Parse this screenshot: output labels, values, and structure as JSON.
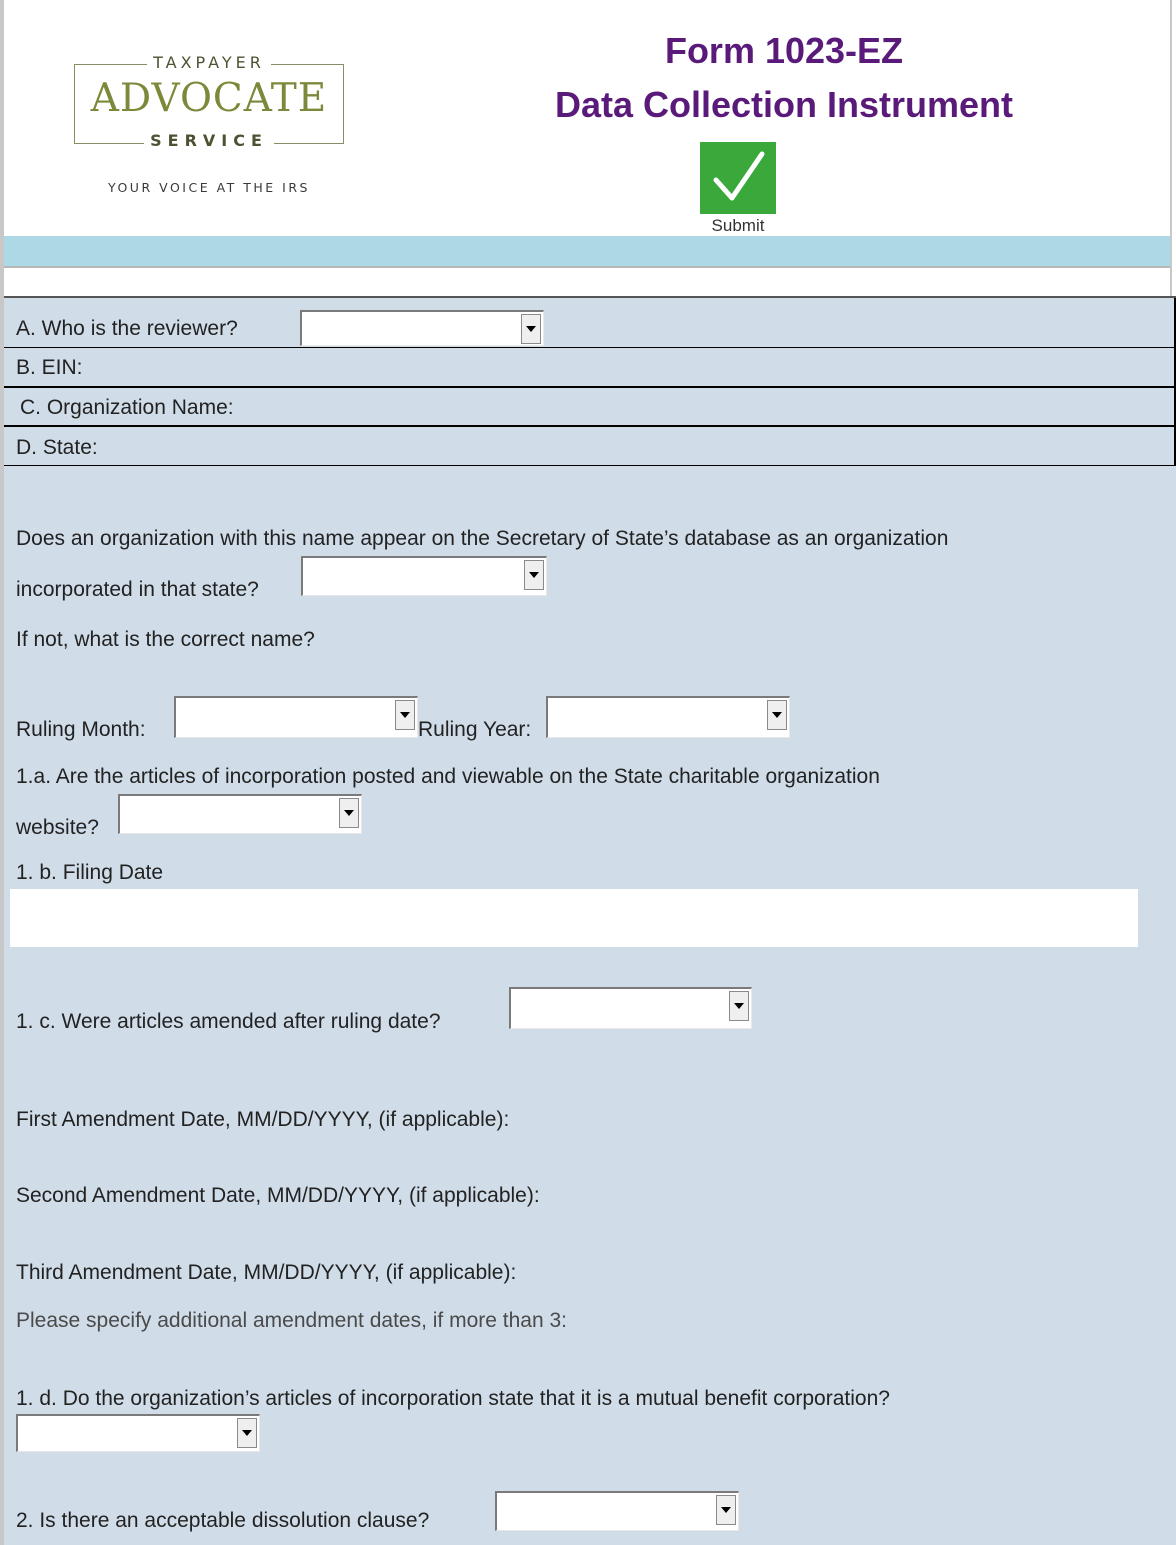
{
  "header": {
    "logo": {
      "top": "TAXPAYER",
      "middle": "ADVOCATE",
      "bottom": "SERVICE",
      "tagline": "YOUR VOICE AT THE IRS"
    },
    "title_line1": "Form 1023-EZ",
    "title_line2": "Data Collection Instrument",
    "submit_label": "Submit"
  },
  "colors": {
    "title": "#5a1a7a",
    "band": "#add8e6",
    "form_bg": "#d0dde8",
    "submit_green": "#3aa83a"
  },
  "form": {
    "reviewer_label": "A. Who is the reviewer?",
    "ein_label": "B. EIN:",
    "org_name_label": "C. Organization Name:",
    "state_label": "D. State:",
    "sos_question_line1": "Does an organization with this name appear on the Secretary of State’s database as an organization",
    "sos_question_line2": "incorporated in that state?",
    "correct_name_label": "If not, what is the correct name?",
    "ruling_month_label": "Ruling Month:",
    "ruling_year_label": "Ruling Year:",
    "q1a_line1": "1.a. Are the articles of incorporation posted and viewable on the State charitable organization",
    "q1a_line2": "website?",
    "q1b_label": "1. b. Filing Date",
    "q1c_label": "1. c. Were articles amended after ruling date?",
    "first_amendment_label": "First Amendment Date, MM/DD/YYYY, (if applicable):",
    "second_amendment_label": "Second Amendment Date, MM/DD/YYYY, (if applicable):",
    "third_amendment_label": "Third Amendment Date, MM/DD/YYYY, (if applicable):",
    "additional_amendments_label": "Please specify additional amendment dates, if more than 3:",
    "q1d_label": "1. d. Do the organization’s articles of incorporation state that it is a mutual benefit corporation?",
    "q2_label": "2. Is there an acceptable dissolution clause?"
  },
  "icons": {
    "dropdown": "chevron-down-icon",
    "submit": "checkmark-icon"
  }
}
